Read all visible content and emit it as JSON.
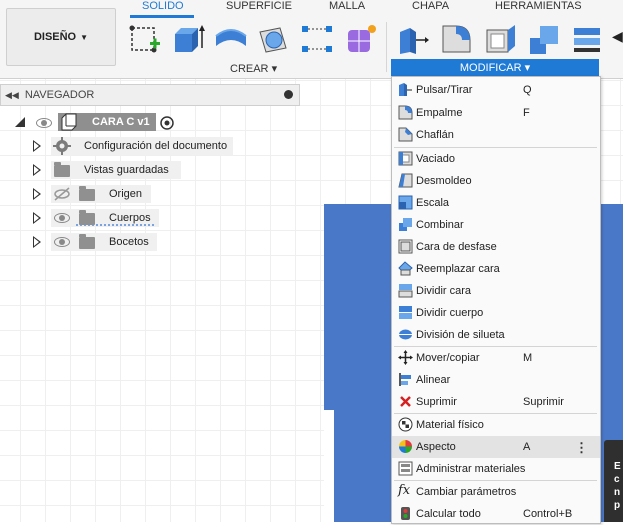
{
  "toolbar": {
    "design_label": "DISEÑO",
    "tabs": [
      {
        "label": "SOLIDO",
        "active": true
      },
      {
        "label": "SUPERFICIE",
        "active": false
      },
      {
        "label": "MALLA",
        "active": false
      },
      {
        "label": "CHAPA",
        "active": false
      },
      {
        "label": "HERRAMIENTAS",
        "active": false
      }
    ],
    "create_label": "CREAR",
    "modify_label": "MODIFICAR",
    "accent_color": "#1f7ad6"
  },
  "navigator": {
    "title": "NAVEGADOR",
    "root": "CARA C v1",
    "items": [
      {
        "label": "Configuración del documento",
        "icon": "gear-icon"
      },
      {
        "label": "Vistas guardadas",
        "icon": "folder-icon"
      },
      {
        "label": "Origen",
        "icon": "folder-icon",
        "visibility": "hidden"
      },
      {
        "label": "Cuerpos",
        "icon": "folder-icon",
        "visibility": "visible"
      },
      {
        "label": "Bocetos",
        "icon": "folder-icon",
        "visibility": "visible"
      }
    ]
  },
  "modify_menu": {
    "items": [
      {
        "label": "Pulsar/Tirar",
        "shortcut": "Q",
        "icon": "press-pull-icon"
      },
      {
        "label": "Empalme",
        "shortcut": "F",
        "icon": "fillet-icon"
      },
      {
        "label": "Chaflán",
        "shortcut": "",
        "icon": "chamfer-icon"
      },
      {
        "label": "Vaciado",
        "shortcut": "",
        "icon": "shell-icon"
      },
      {
        "label": "Desmoldeo",
        "shortcut": "",
        "icon": "draft-icon"
      },
      {
        "label": "Escala",
        "shortcut": "",
        "icon": "scale-icon"
      },
      {
        "label": "Combinar",
        "shortcut": "",
        "icon": "combine-icon"
      },
      {
        "label": "Cara de desfase",
        "shortcut": "",
        "icon": "offset-face-icon"
      },
      {
        "label": "Reemplazar cara",
        "shortcut": "",
        "icon": "replace-face-icon"
      },
      {
        "label": "Dividir cara",
        "shortcut": "",
        "icon": "split-face-icon"
      },
      {
        "label": "Dividir cuerpo",
        "shortcut": "",
        "icon": "split-body-icon"
      },
      {
        "label": "División de silueta",
        "shortcut": "",
        "icon": "silhouette-split-icon"
      },
      {
        "label": "Mover/copiar",
        "shortcut": "M",
        "icon": "move-icon"
      },
      {
        "label": "Alinear",
        "shortcut": "",
        "icon": "align-icon"
      },
      {
        "label": "Suprimir",
        "shortcut": "Suprimir",
        "icon": "delete-icon"
      },
      {
        "label": "Material físico",
        "shortcut": "",
        "icon": "physical-material-icon"
      },
      {
        "label": "Aspecto",
        "shortcut": "A",
        "icon": "appearance-icon"
      },
      {
        "label": "Administrar materiales",
        "shortcut": "",
        "icon": "manage-materials-icon"
      },
      {
        "label": "Cambiar parámetros",
        "shortcut": "",
        "icon": "parameters-icon"
      },
      {
        "label": "Calcular todo",
        "shortcut": "Control+B",
        "icon": "compute-all-icon"
      }
    ]
  },
  "tooltip": {
    "text": "E c n p"
  },
  "body_color": "#4a78c8"
}
